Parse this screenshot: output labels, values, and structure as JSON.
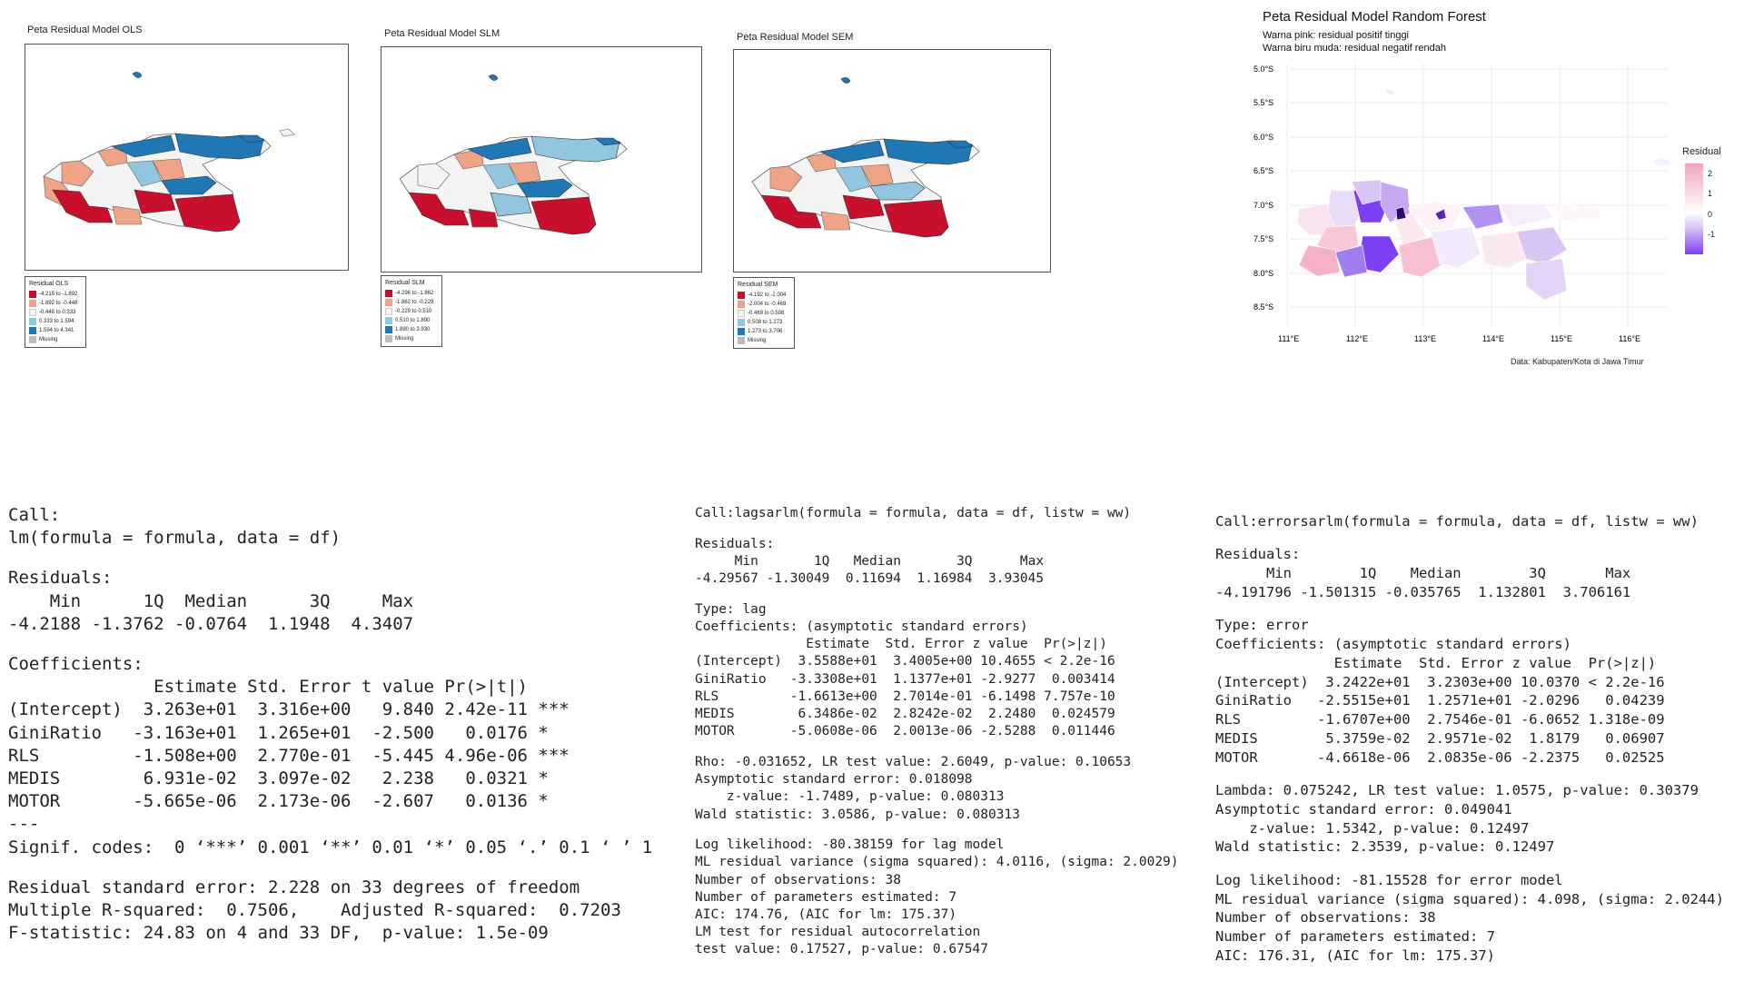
{
  "maps": {
    "ols": {
      "title": "Peta Residual Model OLS",
      "legend_title": "Residual OLS",
      "legend": [
        "-4.219 to -1.892",
        "-1.892 to -0.448",
        "-0.448 to 0.333",
        "0.333 to 1.594",
        "1.594 to 4.341",
        "Missing"
      ]
    },
    "slm": {
      "title": "Peta Residual Model SLM",
      "legend_title": "Residual SLM",
      "legend": [
        "-4.296 to -1.862",
        "-1.862 to -0.229",
        "-0.229 to 0.510",
        "0.510 to 1.890",
        "1.890 to 3.930",
        "Missing"
      ]
    },
    "sem": {
      "title": "Peta Residual Model SEM",
      "legend_title": "Residual SEM",
      "legend": [
        "-4.192 to -2.004",
        "-2.004 to -0.469",
        "-0.469 to 0.508",
        "0.508 to 1.273",
        "1.273 to 3.706",
        "Missing"
      ]
    },
    "colors": [
      "#c8102e",
      "#f0a487",
      "#f4f4f4",
      "#92c5de",
      "#1f77b4",
      "#bdbdbd"
    ]
  },
  "rf": {
    "title": "Peta Residual Model Random Forest",
    "subtitle1": "Warna pink: residual positif tinggi",
    "subtitle2": "Warna biru muda: residual negatif rendah",
    "legend_title": "Residual",
    "legend_ticks": [
      "2",
      "1",
      "0",
      "-1"
    ],
    "lat_ticks": [
      "5.0°S",
      "5.5°S",
      "6.0°S",
      "6.5°S",
      "7.0°S",
      "7.5°S",
      "8.0°S",
      "8.5°S"
    ],
    "lon_ticks": [
      "111°E",
      "112°E",
      "113°E",
      "114°E",
      "115°E",
      "116°E"
    ],
    "caption": "Data: Kabupaten/Kota di Jawa Timur"
  },
  "outputs": {
    "ols": [
      "Call:",
      "lm(formula = formula, data = df)",
      "",
      "Residuals:",
      "    Min      1Q  Median      3Q     Max",
      "-4.2188 -1.3762 -0.0764  1.1948  4.3407",
      "",
      "Coefficients:",
      "              Estimate Std. Error t value Pr(>|t|)",
      "(Intercept)  3.263e+01  3.316e+00   9.840 2.42e-11 ***",
      "GiniRatio   -3.163e+01  1.265e+01  -2.500   0.0176 *",
      "RLS         -1.508e+00  2.770e-01  -5.445 4.96e-06 ***",
      "MEDIS        6.931e-02  3.097e-02   2.238   0.0321 *",
      "MOTOR       -5.665e-06  2.173e-06  -2.607   0.0136 *",
      "---",
      "Signif. codes:  0 ‘***’ 0.001 ‘**’ 0.01 ‘*’ 0.05 ‘.’ 0.1 ‘ ’ 1",
      "",
      "Residual standard error: 2.228 on 33 degrees of freedom",
      "Multiple R-squared:  0.7506,    Adjusted R-squared:  0.7203",
      "F-statistic: 24.83 on 4 and 33 DF,  p-value: 1.5e-09"
    ],
    "slm": [
      "Call:lagsarlm(formula = formula, data = df, listw = ww)",
      "",
      "Residuals:",
      "     Min       1Q   Median       3Q      Max",
      "-4.29567 -1.30049  0.11694  1.16984  3.93045",
      "",
      "Type: lag",
      "Coefficients: (asymptotic standard errors)",
      "              Estimate  Std. Error z value  Pr(>|z|)",
      "(Intercept)  3.5588e+01  3.4005e+00 10.4655 < 2.2e-16",
      "GiniRatio   -3.3308e+01  1.1377e+01 -2.9277  0.003414",
      "RLS         -1.6613e+00  2.7014e-01 -6.1498 7.757e-10",
      "MEDIS        6.3486e-02  2.8242e-02  2.2480  0.024579",
      "MOTOR       -5.0608e-06  2.0013e-06 -2.5288  0.011446",
      "",
      "Rho: -0.031652, LR test value: 2.6049, p-value: 0.10653",
      "Asymptotic standard error: 0.018098",
      "    z-value: -1.7489, p-value: 0.080313",
      "Wald statistic: 3.0586, p-value: 0.080313",
      "",
      "Log likelihood: -80.38159 for lag model",
      "ML residual variance (sigma squared): 4.0116, (sigma: 2.0029)",
      "Number of observations: 38",
      "Number of parameters estimated: 7",
      "AIC: 174.76, (AIC for lm: 175.37)",
      "LM test for residual autocorrelation",
      "test value: 0.17527, p-value: 0.67547"
    ],
    "sem": [
      "Call:errorsarlm(formula = formula, data = df, listw = ww)",
      "",
      "Residuals:",
      "      Min        1Q    Median        3Q       Max",
      "-4.191796 -1.501315 -0.035765  1.132801  3.706161",
      "",
      "Type: error",
      "Coefficients: (asymptotic standard errors)",
      "              Estimate  Std. Error z value  Pr(>|z|)",
      "(Intercept)  3.2422e+01  3.2303e+00 10.0370 < 2.2e-16",
      "GiniRatio   -2.5515e+01  1.2571e+01 -2.0296   0.04239",
      "RLS         -1.6707e+00  2.7546e-01 -6.0652 1.318e-09",
      "MEDIS        5.3759e-02  2.9571e-02  1.8179   0.06907",
      "MOTOR       -4.6618e-06  2.0835e-06 -2.2375   0.02525",
      "",
      "Lambda: 0.075242, LR test value: 1.0575, p-value: 0.30379",
      "Asymptotic standard error: 0.049041",
      "    z-value: 1.5342, p-value: 0.12497",
      "Wald statistic: 2.3539, p-value: 0.12497",
      "",
      "Log likelihood: -81.15528 for error model",
      "ML residual variance (sigma squared): 4.098, (sigma: 2.0244)",
      "Number of observations: 38",
      "Number of parameters estimated: 7",
      "AIC: 176.31, (AIC for lm: 175.37)"
    ]
  }
}
